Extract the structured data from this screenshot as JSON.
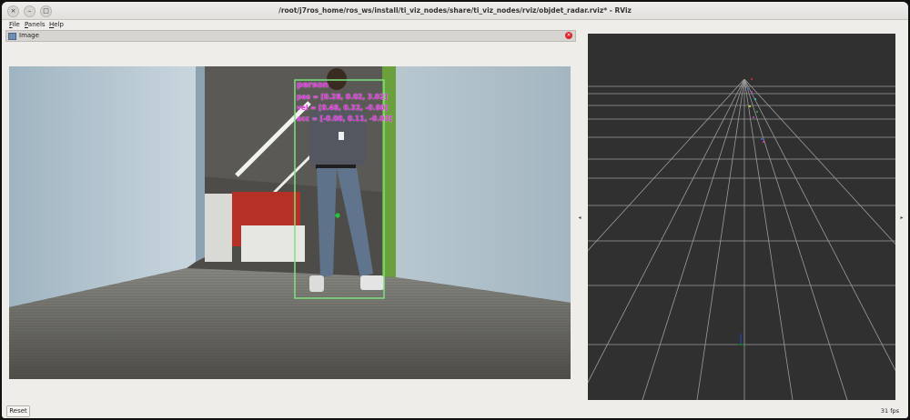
{
  "window": {
    "title": "/root/j7ros_home/ros_ws/install/ti_viz_nodes/share/ti_viz_nodes/rviz/objdet_radar.rviz* - RViz",
    "close_symbol": "×",
    "minimize_symbol": "–",
    "maximize_symbol": "□"
  },
  "menu": {
    "file_key": "F",
    "file_rest": "ile",
    "panels_key": "P",
    "panels_rest": "anels",
    "help_key": "H",
    "help_rest": "elp"
  },
  "image_panel": {
    "title": "Image",
    "close_symbol": "×",
    "detection": {
      "label": "person",
      "pos": "pos = [0.28, 0.02, 3.02]",
      "vel": "vel = [0.48, 0.32, -0.60]",
      "acc": "acc = [-0.00, 0.11, -0.03]",
      "box_color": "#7de37d",
      "label_color": "#e02ae0"
    }
  },
  "splitter": {
    "left_arrow": "◂",
    "right_arrow": "▸"
  },
  "rviz_3d": {
    "background": "#303030",
    "grid_color": "#a0a0a0"
  },
  "statusbar": {
    "reset_label": "Reset",
    "fps": "31 fps"
  }
}
